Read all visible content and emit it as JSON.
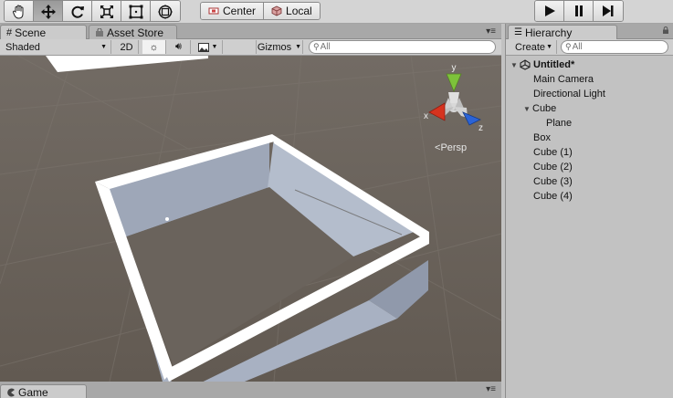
{
  "toolbar": {
    "tools": [
      {
        "name": "hand-tool",
        "icon": "hand-icon"
      },
      {
        "name": "move-tool",
        "icon": "move-arrows-icon",
        "active": true
      },
      {
        "name": "rotate-tool",
        "icon": "rotate-icon"
      },
      {
        "name": "scale-tool",
        "icon": "scale-icon"
      },
      {
        "name": "rect-tool",
        "icon": "rect-icon"
      },
      {
        "name": "transform-tool",
        "icon": "transform-icon"
      }
    ],
    "pivot_label": "Center",
    "space_label": "Local",
    "play_icons": [
      "play-icon",
      "pause-icon",
      "step-icon"
    ]
  },
  "scene": {
    "tabs": [
      {
        "label": "Scene",
        "icon": "grid-icon",
        "active": true
      },
      {
        "label": "Asset Store",
        "icon": "bag-icon",
        "active": false
      }
    ],
    "shading_mode": "Shaded",
    "mode_2d": "2D",
    "gizmos_label": "Gizmos",
    "search_placeholder": "All",
    "persp_label": "Persp",
    "axis_labels": {
      "x": "x",
      "y": "y",
      "z": "z"
    },
    "colors": {
      "x": "#d6331f",
      "y": "#7dc23a",
      "z": "#2b63d6",
      "background": "#6d665f"
    }
  },
  "game_tab": {
    "label": "Game",
    "icon": "pacman-icon"
  },
  "hierarchy": {
    "tab_label": "Hierarchy",
    "create_label": "Create",
    "search_placeholder": "All",
    "items": [
      {
        "label": "Untitled*",
        "level": 0,
        "expanded": true,
        "bold": true,
        "icon": "unity-icon"
      },
      {
        "label": "Main Camera",
        "level": 1
      },
      {
        "label": "Directional Light",
        "level": 1
      },
      {
        "label": "Cube",
        "level": 1,
        "expanded": true
      },
      {
        "label": "Plane",
        "level": 2
      },
      {
        "label": "Box",
        "level": 1
      },
      {
        "label": "Cube (1)",
        "level": 1
      },
      {
        "label": "Cube (2)",
        "level": 1
      },
      {
        "label": "Cube (3)",
        "level": 1
      },
      {
        "label": "Cube (4)",
        "level": 1
      }
    ]
  }
}
